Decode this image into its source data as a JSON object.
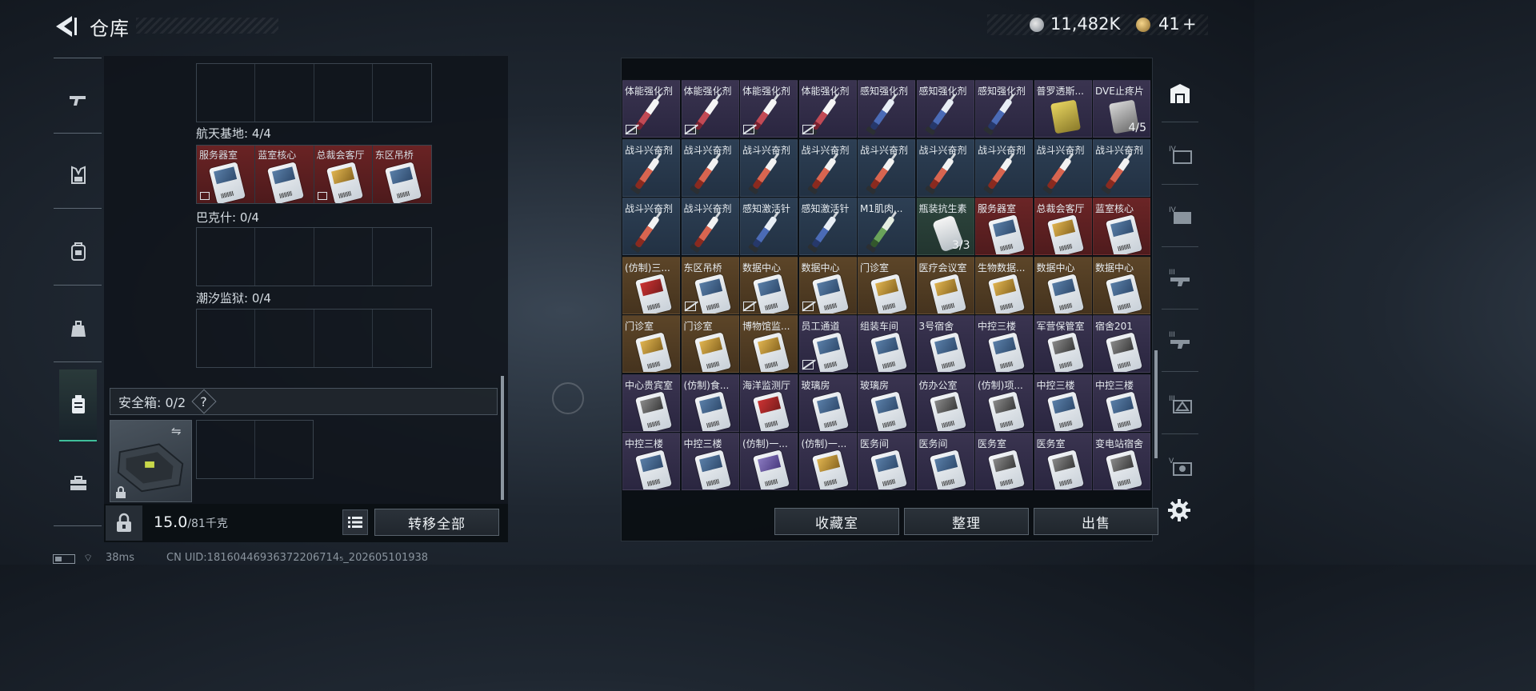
{
  "header": {
    "title": "仓库",
    "currency_silver": "11,482K",
    "currency_gold": "41",
    "currency_gold_plus": "+"
  },
  "left_nav": {
    "items": [
      "gun-icon",
      "vest-icon",
      "backpack-icon",
      "pouch-icon",
      "safe-case-icon",
      "toolbox-icon"
    ],
    "active_index": 4
  },
  "containers": [
    {
      "label": "航天基地: 4/4",
      "items": [
        "服务器室",
        "蓝室核心",
        "总裁会客厅",
        "东区吊桥"
      ]
    },
    {
      "label": "巴克什: 0/4",
      "items": []
    },
    {
      "label": "潮汐监狱: 0/4",
      "items": []
    }
  ],
  "safe": {
    "label": "安全箱: 0/2",
    "help": "?"
  },
  "weight": {
    "current": "15.0",
    "max": "/81千克"
  },
  "buttons": {
    "transfer_all": "转移全部",
    "collection": "收藏室",
    "organize": "整理",
    "sell": "出售"
  },
  "inventory": {
    "rows": [
      [
        {
          "name": "体能强化剂",
          "kind": "syringe-white",
          "bg": "purple",
          "nolink": true
        },
        {
          "name": "体能强化剂",
          "kind": "syringe-white",
          "bg": "purple",
          "nolink": true
        },
        {
          "name": "体能强化剂",
          "kind": "syringe-white",
          "bg": "purple",
          "nolink": true
        },
        {
          "name": "体能强化剂",
          "kind": "syringe-white",
          "bg": "purple",
          "nolink": true
        },
        {
          "name": "感知强化剂",
          "kind": "syringe-blue",
          "bg": "purple",
          "nolink": false
        },
        {
          "name": "感知强化剂",
          "kind": "syringe-blue",
          "bg": "purple",
          "nolink": false
        },
        {
          "name": "感知强化剂",
          "kind": "syringe-blue",
          "bg": "purple",
          "nolink": false
        },
        {
          "name": "普罗透斯...",
          "kind": "pillbox-gold",
          "bg": "purple",
          "nolink": false
        },
        {
          "name": "DVE止疼片",
          "kind": "pillbox-dark",
          "bg": "purple",
          "nolink": false,
          "count": "4/5"
        }
      ],
      [
        {
          "name": "战斗兴奋剂",
          "kind": "syringe-red",
          "bg": "blue"
        },
        {
          "name": "战斗兴奋剂",
          "kind": "syringe-red",
          "bg": "blue"
        },
        {
          "name": "战斗兴奋剂",
          "kind": "syringe-red",
          "bg": "blue"
        },
        {
          "name": "战斗兴奋剂",
          "kind": "syringe-red",
          "bg": "blue"
        },
        {
          "name": "战斗兴奋剂",
          "kind": "syringe-red",
          "bg": "blue"
        },
        {
          "name": "战斗兴奋剂",
          "kind": "syringe-red",
          "bg": "blue"
        },
        {
          "name": "战斗兴奋剂",
          "kind": "syringe-red",
          "bg": "blue"
        },
        {
          "name": "战斗兴奋剂",
          "kind": "syringe-red",
          "bg": "blue"
        },
        {
          "name": "战斗兴奋剂",
          "kind": "syringe-red",
          "bg": "blue"
        }
      ],
      [
        {
          "name": "战斗兴奋剂",
          "kind": "syringe-red",
          "bg": "blue"
        },
        {
          "name": "战斗兴奋剂",
          "kind": "syringe-red",
          "bg": "blue"
        },
        {
          "name": "感知激活针",
          "kind": "syringe-blue",
          "bg": "blue"
        },
        {
          "name": "感知激活针",
          "kind": "syringe-blue",
          "bg": "blue"
        },
        {
          "name": "M1肌肉...",
          "kind": "syringe-green",
          "bg": "blue"
        },
        {
          "name": "瓶装抗生素",
          "kind": "bottle",
          "bg": "green",
          "count": "3/3"
        },
        {
          "name": "服务器室",
          "kind": "card",
          "bg": "red"
        },
        {
          "name": "总裁会客厅",
          "kind": "card-gold",
          "bg": "red"
        },
        {
          "name": "蓝室核心",
          "kind": "card",
          "bg": "red"
        }
      ],
      [
        {
          "name": "(仿制)三...",
          "kind": "card-red",
          "bg": "gold"
        },
        {
          "name": "东区吊桥",
          "kind": "card",
          "bg": "gold",
          "nolink": true
        },
        {
          "name": "数据中心",
          "kind": "card",
          "bg": "gold",
          "nolink": true
        },
        {
          "name": "数据中心",
          "kind": "card",
          "bg": "gold",
          "nolink": true
        },
        {
          "name": "门诊室",
          "kind": "card-gold",
          "bg": "gold"
        },
        {
          "name": "医疗会议室",
          "kind": "card-gold",
          "bg": "gold"
        },
        {
          "name": "生物数据...",
          "kind": "card-gold",
          "bg": "gold"
        },
        {
          "name": "数据中心",
          "kind": "card",
          "bg": "gold"
        },
        {
          "name": "数据中心",
          "kind": "card",
          "bg": "gold"
        }
      ],
      [
        {
          "name": "门诊室",
          "kind": "card-gold",
          "bg": "gold"
        },
        {
          "name": "门诊室",
          "kind": "card-gold",
          "bg": "gold"
        },
        {
          "name": "博物馆监...",
          "kind": "card-gold",
          "bg": "gold"
        },
        {
          "name": "员工通道",
          "kind": "card",
          "bg": "purple",
          "nolink": true
        },
        {
          "name": "组装车间",
          "kind": "card",
          "bg": "purple"
        },
        {
          "name": "3号宿舍",
          "kind": "card",
          "bg": "purple"
        },
        {
          "name": "中控三楼",
          "kind": "card",
          "bg": "purple"
        },
        {
          "name": "军营保管室",
          "kind": "card-dark",
          "bg": "purple"
        },
        {
          "name": "宿舍201",
          "kind": "card-dark",
          "bg": "purple"
        }
      ],
      [
        {
          "name": "中心贵宾室",
          "kind": "card-dark",
          "bg": "purple"
        },
        {
          "name": "(仿制)食...",
          "kind": "card",
          "bg": "purple"
        },
        {
          "name": "海洋监测厅",
          "kind": "card-red",
          "bg": "purple"
        },
        {
          "name": "玻璃房",
          "kind": "card",
          "bg": "purple"
        },
        {
          "name": "玻璃房",
          "kind": "card",
          "bg": "purple"
        },
        {
          "name": "仿办公室",
          "kind": "card-dark",
          "bg": "purple"
        },
        {
          "name": "(仿制)项...",
          "kind": "card-dark",
          "bg": "purple"
        },
        {
          "name": "中控三楼",
          "kind": "card",
          "bg": "purple"
        },
        {
          "name": "中控三楼",
          "kind": "card",
          "bg": "purple"
        }
      ],
      [
        {
          "name": "中控三楼",
          "kind": "card",
          "bg": "purple"
        },
        {
          "name": "中控三楼",
          "kind": "card",
          "bg": "purple"
        },
        {
          "name": "(仿制)一...",
          "kind": "card-purple",
          "bg": "purple"
        },
        {
          "name": "(仿制)一...",
          "kind": "card-gold",
          "bg": "purple"
        },
        {
          "name": "医务间",
          "kind": "card",
          "bg": "purple"
        },
        {
          "name": "医务间",
          "kind": "card",
          "bg": "purple"
        },
        {
          "name": "医务室",
          "kind": "card-dark",
          "bg": "purple"
        },
        {
          "name": "医务室",
          "kind": "card-dark",
          "bg": "purple"
        },
        {
          "name": "变电站宿舍",
          "kind": "card-dark",
          "bg": "purple"
        }
      ]
    ]
  },
  "right_nav": {
    "items": [
      "warehouse-icon",
      "tier-iv-case-icon",
      "tier-iv-case-icon",
      "tier-iii-gun-icon",
      "tier-iii-gun-icon",
      "tier-iii-case-icon",
      "tier-v-case-icon"
    ]
  },
  "status": {
    "ping": "38ms",
    "uid": "CN UID:18160446936372206714₅_202605101938"
  }
}
